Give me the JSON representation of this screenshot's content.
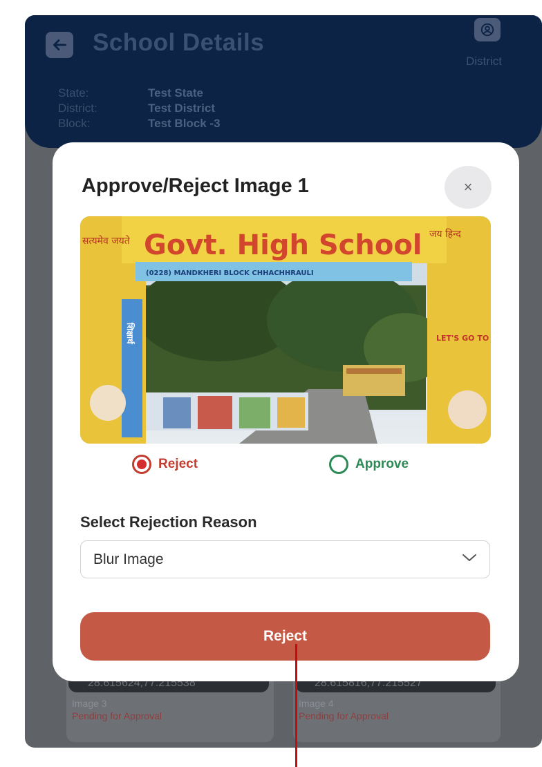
{
  "header": {
    "title": "School Details",
    "district_button": "District",
    "info": [
      {
        "key": "State:",
        "value": "Test State"
      },
      {
        "key": "District:",
        "value": "Test District"
      },
      {
        "key": "Block:",
        "value": "Test Block -3"
      }
    ]
  },
  "background_cards": [
    {
      "coords": "28.615624,77.215538",
      "label": "Image 3",
      "status": "Pending for Approval"
    },
    {
      "coords": "28.615816,77.215527",
      "label": "Image 4",
      "status": "Pending for Approval"
    }
  ],
  "modal": {
    "title": "Approve/Reject Image 1",
    "close_icon": "×",
    "photo": {
      "headline": "Govt. High School",
      "sub": "(0228) MANDKHERI BLOCK CHHACHHRAULI",
      "left_hindi": "सत्यमेव जयते",
      "right_hindi": "जय हिन्द",
      "side_text": "LET'S GO TO SCHOOL",
      "pillar_text": "शिक्षार्थ"
    },
    "options": {
      "reject": "Reject",
      "approve": "Approve",
      "selected": "Reject"
    },
    "select_label": "Select Rejection Reason",
    "select_value": "Blur Image",
    "submit_label": "Reject"
  },
  "colors": {
    "header_bg": "#0c2345",
    "reject_red": "#c23c2f",
    "approve_green": "#2b8a55",
    "button_bg": "#c45a45"
  }
}
